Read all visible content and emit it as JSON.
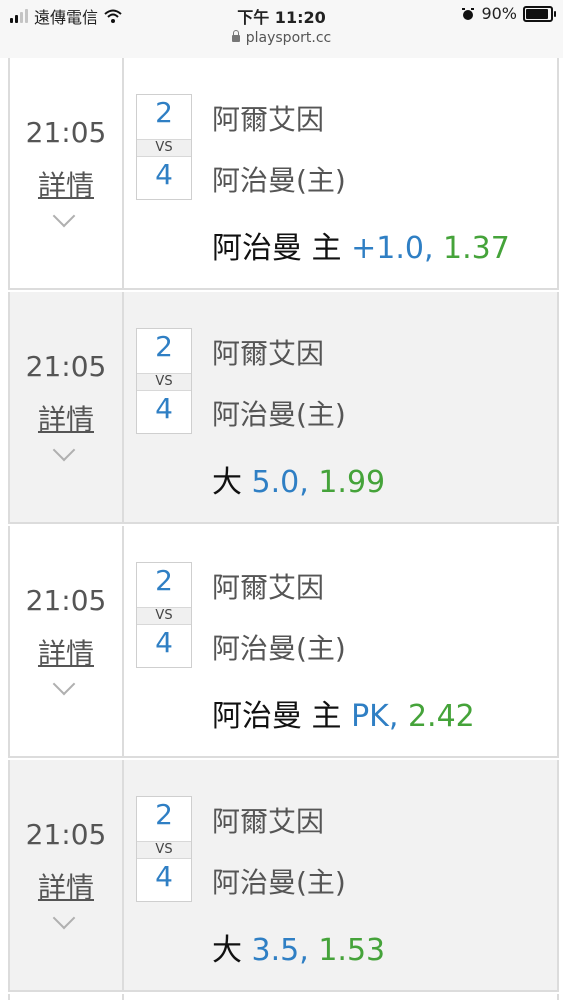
{
  "status_bar": {
    "carrier": "遠傳電信",
    "time": "下午 11:20",
    "battery": "90%",
    "url": "playsport.cc"
  },
  "matches": [
    {
      "time": "21:05",
      "detail_label": "詳情",
      "home_score": "2",
      "vs_label": "VS",
      "away_score": "4",
      "team_top": "阿爾艾因",
      "team_bottom": "阿治曼(主)",
      "bet_label": "阿治曼 主",
      "bet_line": "+1.0,",
      "bet_odds": "1.37"
    },
    {
      "time": "21:05",
      "detail_label": "詳情",
      "home_score": "2",
      "vs_label": "VS",
      "away_score": "4",
      "team_top": "阿爾艾因",
      "team_bottom": "阿治曼(主)",
      "bet_label": "大",
      "bet_line": "5.0,",
      "bet_odds": "1.99"
    },
    {
      "time": "21:05",
      "detail_label": "詳情",
      "home_score": "2",
      "vs_label": "VS",
      "away_score": "4",
      "team_top": "阿爾艾因",
      "team_bottom": "阿治曼(主)",
      "bet_label": "阿治曼 主",
      "bet_line": "PK,",
      "bet_odds": "2.42"
    },
    {
      "time": "21:05",
      "detail_label": "詳情",
      "home_score": "2",
      "vs_label": "VS",
      "away_score": "4",
      "team_top": "阿爾艾因",
      "team_bottom": "阿治曼(主)",
      "bet_label": "大",
      "bet_line": "3.5,",
      "bet_odds": "1.53"
    }
  ],
  "colors": {
    "line_blue": "#2f7fc4",
    "odds_green": "#45a33a",
    "row_shaded": "#f2f2f2",
    "border": "#dcdcdc"
  }
}
